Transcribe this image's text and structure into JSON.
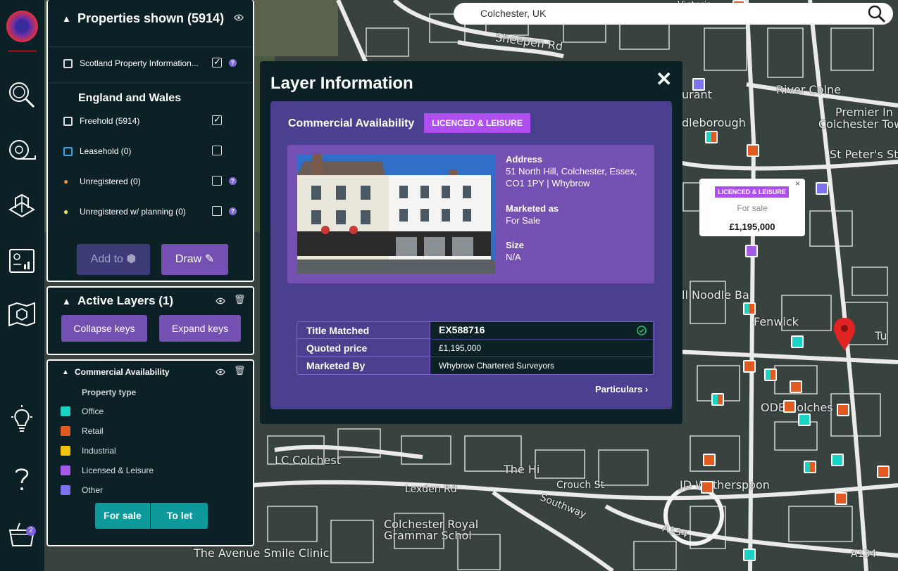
{
  "search": {
    "value": "Colchester, UK"
  },
  "map_labels": [
    "Sheepen Rd",
    "River Colne",
    "Premier In",
    "Colchester Town",
    "St Peter's St",
    "dleborough",
    "ll Noodle Ba",
    "Fenwick",
    "ODE Colches",
    "LC Colchest",
    "The Hi",
    "Lexden Rd",
    "Crouch St",
    "Southway",
    "A134",
    "JD Wetherspoon",
    "Colchester Royal Grammar Schol",
    "The Avenue Smile Clinic",
    "Tu",
    "A134",
    "urant",
    "Victoria"
  ],
  "properties_panel": {
    "title": "Properties shown (5914)",
    "scotland_label": "Scotland Property Information...",
    "section_title": "England and Wales",
    "rows": [
      {
        "label": "Freehold (5914)",
        "checked": true
      },
      {
        "label": "Leasehold (0)",
        "checked": false
      },
      {
        "label": "Unregistered (0)",
        "checked": false
      },
      {
        "label": "Unregistered w/ planning (0)",
        "checked": false
      }
    ],
    "add_to_label": "Add to",
    "draw_label": "Draw"
  },
  "active_layers": {
    "title": "Active Layers (1)",
    "collapse_label": "Collapse keys",
    "expand_label": "Expand keys"
  },
  "commercial_layer": {
    "title": "Commercial Availability",
    "subtitle": "Property type",
    "keys": [
      {
        "label": "Office",
        "color": "#19d3c4"
      },
      {
        "label": "Retail",
        "color": "#e05a22"
      },
      {
        "label": "Industrial",
        "color": "#f2c40c"
      },
      {
        "label": "Licensed & Leisure",
        "color": "#a65be8"
      },
      {
        "label": "Other",
        "color": "#7d72f0"
      }
    ],
    "for_sale_label": "For sale",
    "to_let_label": "To let"
  },
  "dialog": {
    "title": "Layer Information",
    "layer_name": "Commercial Availability",
    "badge": "LICENCED & LEISURE",
    "address_label": "Address",
    "address_line1": "51 North Hill, Colchester, Essex,",
    "address_line2": "CO1 1PY | Whybrow",
    "marketed_label": "Marketed as",
    "marketed_value": "For Sale",
    "size_label": "Size",
    "size_value": "N/A",
    "table": [
      {
        "key": "Title Matched",
        "value": "EX588716"
      },
      {
        "key": "Quoted price",
        "value": "£1,195,000"
      },
      {
        "key": "Marketed By",
        "value": "Whybrow Chartered Surveyors"
      }
    ],
    "particulars_label": "Particulars"
  },
  "popup": {
    "badge": "LICENCED & LEISURE",
    "status": "For sale",
    "price": "£1,195,000"
  },
  "basket_count": "2"
}
